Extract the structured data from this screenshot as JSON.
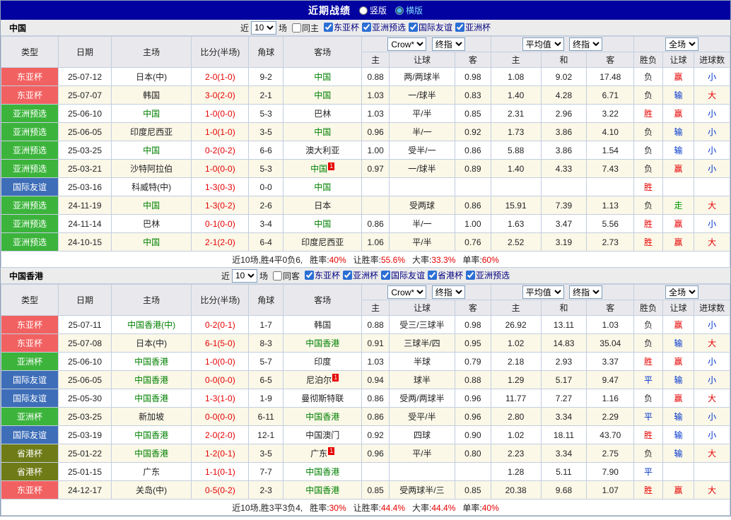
{
  "topbar": {
    "title": "近期战绩",
    "layout_options": [
      {
        "label": "竖版",
        "selected": false
      },
      {
        "label": "横版",
        "selected": true
      }
    ]
  },
  "table_header": {
    "base_cols": [
      "类型",
      "日期",
      "主场",
      "比分(半场)",
      "角球",
      "客场"
    ],
    "bookmaker_select": "Crow*",
    "bookmaker_stage_select": "终指",
    "average_select": "平均值",
    "average_stage_select": "终指",
    "fulltime_select": "全场",
    "odds_cols": [
      "主",
      "让球",
      "客"
    ],
    "avg_cols": [
      "主",
      "和",
      "客"
    ],
    "result_cols": [
      "胜负",
      "让球",
      "进球数"
    ]
  },
  "sections": [
    {
      "title": "中国",
      "filter": {
        "near_label": "近",
        "count": "10",
        "games_label": "场",
        "same_side_label": "同主",
        "leagues": [
          "东亚杯",
          "亚洲预选",
          "国际友谊",
          "亚洲杯"
        ]
      },
      "rows": [
        {
          "type": "东亚杯",
          "date": "25-07-12",
          "home": "日本(中)",
          "home_focal": false,
          "home_badge": "",
          "score": "2-0(1-0)",
          "corner": "9-2",
          "away": "中国",
          "away_focal": true,
          "away_badge": "",
          "odds": [
            "0.88",
            "两/两球半",
            "0.98"
          ],
          "avg": [
            "1.08",
            "9.02",
            "17.48"
          ],
          "wdl": "负",
          "let": "赢",
          "size": "小"
        },
        {
          "type": "东亚杯",
          "date": "25-07-07",
          "home": "韩国",
          "home_focal": false,
          "home_badge": "",
          "score": "3-0(2-0)",
          "corner": "2-1",
          "away": "中国",
          "away_focal": true,
          "away_badge": "",
          "odds": [
            "1.03",
            "一/球半",
            "0.83"
          ],
          "avg": [
            "1.40",
            "4.28",
            "6.71"
          ],
          "wdl": "负",
          "let": "输",
          "size": "大"
        },
        {
          "type": "亚洲预选",
          "date": "25-06-10",
          "home": "中国",
          "home_focal": true,
          "home_badge": "",
          "score": "1-0(0-0)",
          "corner": "5-3",
          "away": "巴林",
          "away_focal": false,
          "away_badge": "",
          "odds": [
            "1.03",
            "平/半",
            "0.85"
          ],
          "avg": [
            "2.31",
            "2.96",
            "3.22"
          ],
          "wdl": "胜",
          "let": "赢",
          "size": "小"
        },
        {
          "type": "亚洲预选",
          "date": "25-06-05",
          "home": "印度尼西亚",
          "home_focal": false,
          "home_badge": "",
          "score": "1-0(1-0)",
          "corner": "3-5",
          "away": "中国",
          "away_focal": true,
          "away_badge": "",
          "odds": [
            "0.96",
            "半/一",
            "0.92"
          ],
          "avg": [
            "1.73",
            "3.86",
            "4.10"
          ],
          "wdl": "负",
          "let": "输",
          "size": "小"
        },
        {
          "type": "亚洲预选",
          "date": "25-03-25",
          "home": "中国",
          "home_focal": true,
          "home_badge": "",
          "score": "0-2(0-2)",
          "corner": "6-6",
          "away": "澳大利亚",
          "away_focal": false,
          "away_badge": "",
          "odds": [
            "1.00",
            "受半/一",
            "0.86"
          ],
          "avg": [
            "5.88",
            "3.86",
            "1.54"
          ],
          "wdl": "负",
          "let": "输",
          "size": "小"
        },
        {
          "type": "亚洲预选",
          "date": "25-03-21",
          "home": "沙特阿拉伯",
          "home_focal": false,
          "home_badge": "",
          "score": "1-0(0-0)",
          "corner": "5-3",
          "away": "中国",
          "away_focal": true,
          "away_badge": "1",
          "odds": [
            "0.97",
            "一/球半",
            "0.89"
          ],
          "avg": [
            "1.40",
            "4.33",
            "7.43"
          ],
          "wdl": "负",
          "let": "赢",
          "size": "小"
        },
        {
          "type": "国际友谊",
          "date": "25-03-16",
          "home": "科威特(中)",
          "home_focal": false,
          "home_badge": "",
          "score": "1-3(0-3)",
          "corner": "0-0",
          "away": "中国",
          "away_focal": true,
          "away_badge": "",
          "odds": [
            "",
            "",
            ""
          ],
          "avg": [
            "",
            "",
            ""
          ],
          "wdl": "胜",
          "let": "",
          "size": ""
        },
        {
          "type": "亚洲预选",
          "date": "24-11-19",
          "home": "中国",
          "home_focal": true,
          "home_badge": "",
          "score": "1-3(0-2)",
          "corner": "2-6",
          "away": "日本",
          "away_focal": false,
          "away_badge": "",
          "odds": [
            "",
            "受两球",
            "0.86"
          ],
          "avg": [
            "15.91",
            "7.39",
            "1.13"
          ],
          "wdl": "负",
          "let": "走",
          "size": "大"
        },
        {
          "type": "亚洲预选",
          "date": "24-11-14",
          "home": "巴林",
          "home_focal": false,
          "home_badge": "",
          "score": "0-1(0-0)",
          "corner": "3-4",
          "away": "中国",
          "away_focal": true,
          "away_badge": "",
          "odds": [
            "0.86",
            "半/一",
            "1.00"
          ],
          "avg": [
            "1.63",
            "3.47",
            "5.56"
          ],
          "wdl": "胜",
          "let": "赢",
          "size": "小"
        },
        {
          "type": "亚洲预选",
          "date": "24-10-15",
          "home": "中国",
          "home_focal": true,
          "home_badge": "",
          "score": "2-1(2-0)",
          "corner": "6-4",
          "away": "印度尼西亚",
          "away_focal": false,
          "away_badge": "",
          "odds": [
            "1.06",
            "平/半",
            "0.76"
          ],
          "avg": [
            "2.52",
            "3.19",
            "2.73"
          ],
          "wdl": "胜",
          "let": "赢",
          "size": "大"
        }
      ],
      "summary": {
        "prefix": "近10场,胜4平0负6,",
        "stats": [
          {
            "label": "胜率:",
            "value": "40%"
          },
          {
            "label": "让胜率:",
            "value": "55.6%"
          },
          {
            "label": "大率:",
            "value": "33.3%"
          },
          {
            "label": "单率:",
            "value": "60%"
          }
        ]
      }
    },
    {
      "title": "中国香港",
      "filter": {
        "near_label": "近",
        "count": "10",
        "games_label": "场",
        "same_side_label": "同客",
        "leagues": [
          "东亚杯",
          "亚洲杯",
          "国际友谊",
          "省港杯",
          "亚洲预选"
        ]
      },
      "rows": [
        {
          "type": "东亚杯",
          "date": "25-07-11",
          "home": "中国香港(中)",
          "home_focal": true,
          "home_badge": "",
          "score": "0-2(0-1)",
          "corner": "1-7",
          "away": "韩国",
          "away_focal": false,
          "away_badge": "",
          "odds": [
            "0.88",
            "受三/三球半",
            "0.98"
          ],
          "avg": [
            "26.92",
            "13.11",
            "1.03"
          ],
          "wdl": "负",
          "let": "赢",
          "size": "小"
        },
        {
          "type": "东亚杯",
          "date": "25-07-08",
          "home": "日本(中)",
          "home_focal": false,
          "home_badge": "",
          "score": "6-1(5-0)",
          "corner": "8-3",
          "away": "中国香港",
          "away_focal": true,
          "away_badge": "",
          "odds": [
            "0.91",
            "三球半/四",
            "0.95"
          ],
          "avg": [
            "1.02",
            "14.83",
            "35.04"
          ],
          "wdl": "负",
          "let": "输",
          "size": "大"
        },
        {
          "type": "亚洲杯",
          "date": "25-06-10",
          "home": "中国香港",
          "home_focal": true,
          "home_badge": "",
          "score": "1-0(0-0)",
          "corner": "5-7",
          "away": "印度",
          "away_focal": false,
          "away_badge": "",
          "odds": [
            "1.03",
            "半球",
            "0.79"
          ],
          "avg": [
            "2.18",
            "2.93",
            "3.37"
          ],
          "wdl": "胜",
          "let": "赢",
          "size": "小"
        },
        {
          "type": "国际友谊",
          "date": "25-06-05",
          "home": "中国香港",
          "home_focal": true,
          "home_badge": "",
          "score": "0-0(0-0)",
          "corner": "6-5",
          "away": "尼泊尔",
          "away_focal": false,
          "away_badge": "1",
          "odds": [
            "0.94",
            "球半",
            "0.88"
          ],
          "avg": [
            "1.29",
            "5.17",
            "9.47"
          ],
          "wdl": "平",
          "let": "输",
          "size": "小"
        },
        {
          "type": "国际友谊",
          "date": "25-05-30",
          "home": "中国香港",
          "home_focal": true,
          "home_badge": "",
          "score": "1-3(1-0)",
          "corner": "1-9",
          "away": "曼彻斯特联",
          "away_focal": false,
          "away_badge": "",
          "odds": [
            "0.86",
            "受两/两球半",
            "0.96"
          ],
          "avg": [
            "11.77",
            "7.27",
            "1.16"
          ],
          "wdl": "负",
          "let": "赢",
          "size": "大"
        },
        {
          "type": "亚洲杯",
          "date": "25-03-25",
          "home": "新加坡",
          "home_focal": false,
          "home_badge": "",
          "score": "0-0(0-0)",
          "corner": "6-11",
          "away": "中国香港",
          "away_focal": true,
          "away_badge": "",
          "odds": [
            "0.86",
            "受平/半",
            "0.96"
          ],
          "avg": [
            "2.80",
            "3.34",
            "2.29"
          ],
          "wdl": "平",
          "let": "输",
          "size": "小"
        },
        {
          "type": "国际友谊",
          "date": "25-03-19",
          "home": "中国香港",
          "home_focal": true,
          "home_badge": "",
          "score": "2-0(2-0)",
          "corner": "12-1",
          "away": "中国澳门",
          "away_focal": false,
          "away_badge": "",
          "odds": [
            "0.92",
            "四球",
            "0.90"
          ],
          "avg": [
            "1.02",
            "18.11",
            "43.70"
          ],
          "wdl": "胜",
          "let": "输",
          "size": "小"
        },
        {
          "type": "省港杯",
          "date": "25-01-22",
          "home": "中国香港",
          "home_focal": true,
          "home_badge": "",
          "score": "1-2(0-1)",
          "corner": "3-5",
          "away": "广东",
          "away_focal": false,
          "away_badge": "1",
          "odds": [
            "0.96",
            "平/半",
            "0.80"
          ],
          "avg": [
            "2.23",
            "3.34",
            "2.75"
          ],
          "wdl": "负",
          "let": "输",
          "size": "大"
        },
        {
          "type": "省港杯",
          "date": "25-01-15",
          "home": "广东",
          "home_focal": false,
          "home_badge": "",
          "score": "1-1(0-1)",
          "corner": "7-7",
          "away": "中国香港",
          "away_focal": true,
          "away_badge": "",
          "odds": [
            "",
            "",
            ""
          ],
          "avg": [
            "1.28",
            "5.11",
            "7.90"
          ],
          "wdl": "平",
          "let": "",
          "size": ""
        },
        {
          "type": "东亚杯",
          "date": "24-12-17",
          "home": "关岛(中)",
          "home_focal": false,
          "home_badge": "",
          "score": "0-5(0-2)",
          "corner": "2-3",
          "away": "中国香港",
          "away_focal": true,
          "away_badge": "",
          "odds": [
            "0.85",
            "受两球半/三",
            "0.85"
          ],
          "avg": [
            "20.38",
            "9.68",
            "1.07"
          ],
          "wdl": "胜",
          "let": "赢",
          "size": "大"
        }
      ],
      "summary": {
        "prefix": "近10场,胜3平3负4,",
        "stats": [
          {
            "label": "胜率:",
            "value": "30%"
          },
          {
            "label": "让胜率:",
            "value": "44.4%"
          },
          {
            "label": "大率:",
            "value": "44.4%"
          },
          {
            "label": "单率:",
            "value": "40%"
          }
        ]
      }
    }
  ],
  "colors": {
    "topbar_bg": "#0202a0",
    "score_text": "#e60000",
    "focal_team": "#008000",
    "league_label": "#000080",
    "selected_layout_label": "#7fd9ff",
    "type_badges": {
      "东亚杯": "#f26161",
      "亚洲预选": "#3cb43c",
      "亚洲杯": "#3cb43c",
      "国际友谊": "#3e6eb8",
      "省港杯": "#6e7b17"
    },
    "outcome": {
      "胜": "#e60000",
      "平": "#0033cc",
      "负": "#333333",
      "赢": "#e60000",
      "输": "#0033cc",
      "走": "#009900",
      "大": "#e60000",
      "小": "#0033cc"
    }
  }
}
